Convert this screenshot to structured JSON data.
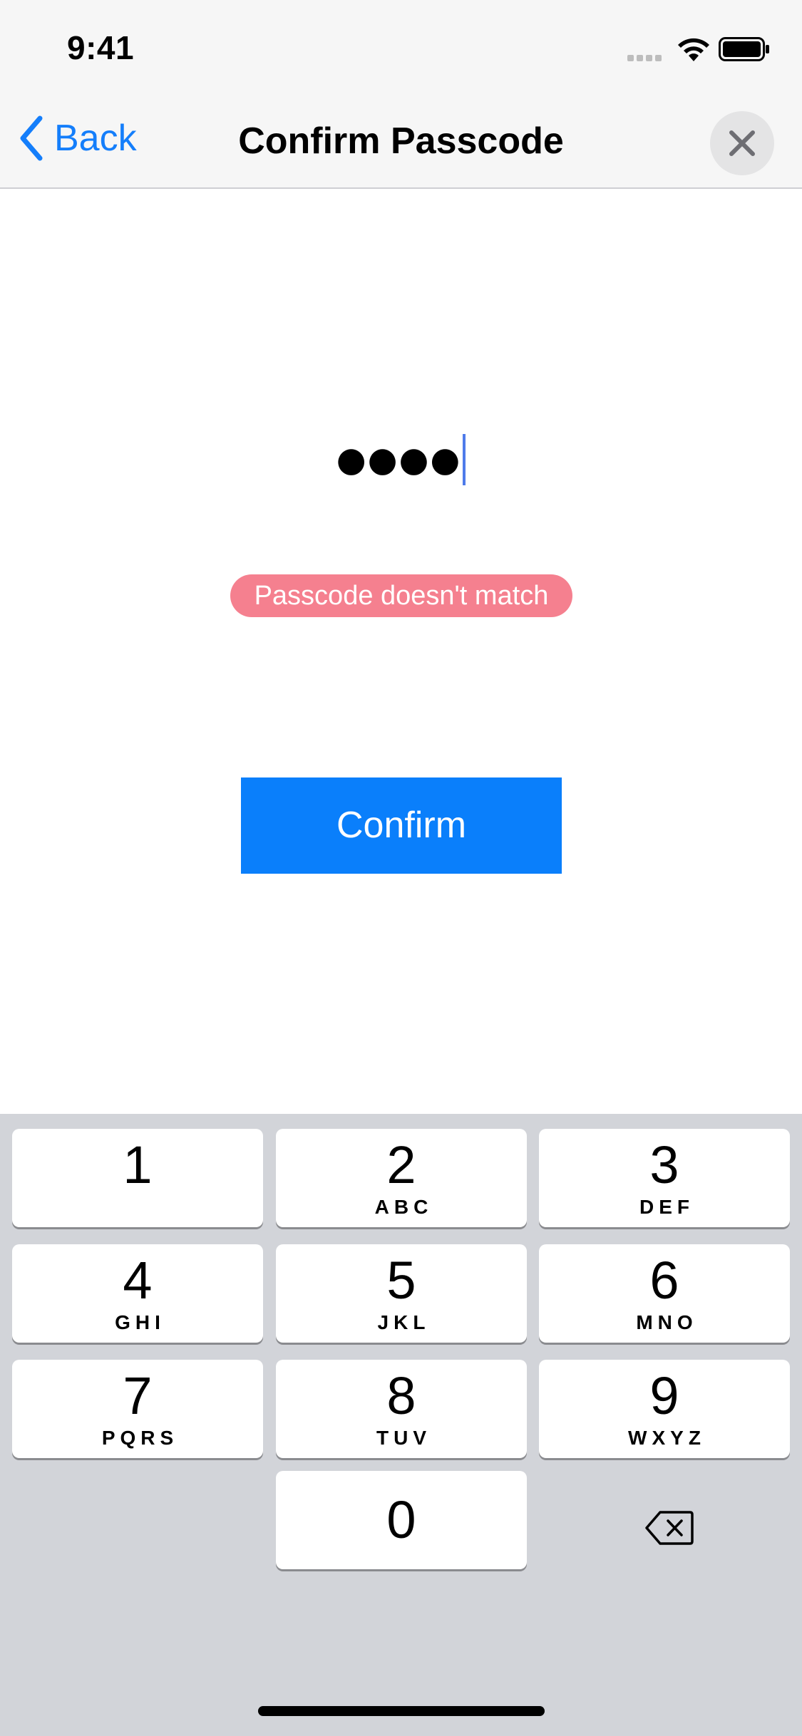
{
  "status_bar": {
    "time": "9:41"
  },
  "nav": {
    "back_label": "Back",
    "title": "Confirm Passcode"
  },
  "passcode": {
    "masked_value": "●●●●"
  },
  "error": {
    "message": "Passcode doesn't match"
  },
  "confirm": {
    "label": "Confirm"
  },
  "keypad": {
    "keys": [
      {
        "digit": "1",
        "letters": ""
      },
      {
        "digit": "2",
        "letters": "ABC"
      },
      {
        "digit": "3",
        "letters": "DEF"
      },
      {
        "digit": "4",
        "letters": "GHI"
      },
      {
        "digit": "5",
        "letters": "JKL"
      },
      {
        "digit": "6",
        "letters": "MNO"
      },
      {
        "digit": "7",
        "letters": "PQRS"
      },
      {
        "digit": "8",
        "letters": "TUV"
      },
      {
        "digit": "9",
        "letters": "WXYZ"
      },
      {
        "digit": "0",
        "letters": ""
      }
    ]
  },
  "colors": {
    "accent": "#147efb",
    "confirm_button": "#0a7ffb",
    "error_badge": "#f5808f",
    "keypad_background": "#d2d4d9",
    "header_background": "#f6f6f6"
  },
  "icons": {
    "back": "chevron-left-icon",
    "close": "close-icon",
    "delete": "backspace-icon",
    "wifi": "wifi-icon",
    "battery": "battery-icon",
    "signal": "signal-icon"
  }
}
